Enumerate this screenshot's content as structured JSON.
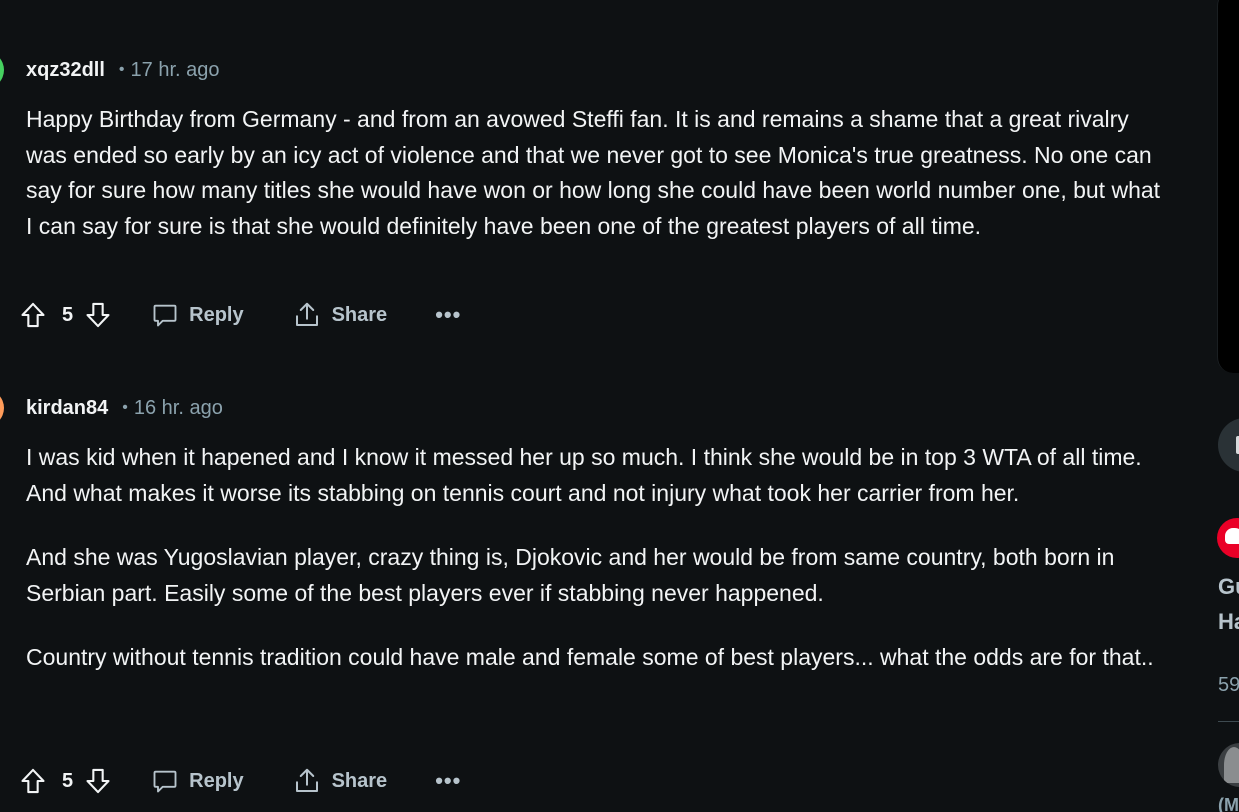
{
  "comments": [
    {
      "author": "xqz32dll",
      "separator": "•",
      "time": "17 hr. ago",
      "paragraphs": [
        "Happy Birthday from Germany - and from an avowed Steffi fan. It is and remains a shame that a great rivalry was ended so early by an icy act of violence and that we never got to see Monica's true greatness. No one can say for sure how many titles she would have won or how long she could have been world number one, but what I can say for sure is that she would definitely have been one of the greatest players of all time."
      ],
      "score": "5",
      "reply_label": "Reply",
      "share_label": "Share",
      "more_label": "•••"
    },
    {
      "author": "kirdan84",
      "separator": "•",
      "time": "16 hr. ago",
      "paragraphs": [
        "I was kid when it hapened and I know it messed her up so much. I think she would be in top 3 WTA of all time. And what makes it worse its stabbing on tennis court and not injury what took her carrier from her.",
        "And she was Yugoslavian player, crazy thing is, Djokovic and her would be from same country, both born in Serbian part. Easily some of the best players ever if stabbing never happened.",
        "Country without tennis tradition could have male and female some of best players... what the odds are for that.."
      ],
      "score": "5",
      "reply_label": "Reply",
      "share_label": "Share",
      "more_label": "•••"
    }
  ],
  "sidebar": {
    "text_line1": "Gu",
    "text_line2": "Ha",
    "count": "59",
    "text_line3": "(M"
  },
  "colors": {
    "background": "#0e1113",
    "text": "#f2f4f5",
    "muted": "#8ba2ad",
    "action": "#b7c4cc",
    "avatar1": "#46d160",
    "avatar2": "#ff9c5a",
    "badge": "#ea0027"
  },
  "icons": {
    "upvote": "arrow-up-icon",
    "downvote": "arrow-down-icon",
    "reply": "speech-bubble-icon",
    "share": "share-upload-icon",
    "more": "ellipsis-icon"
  }
}
